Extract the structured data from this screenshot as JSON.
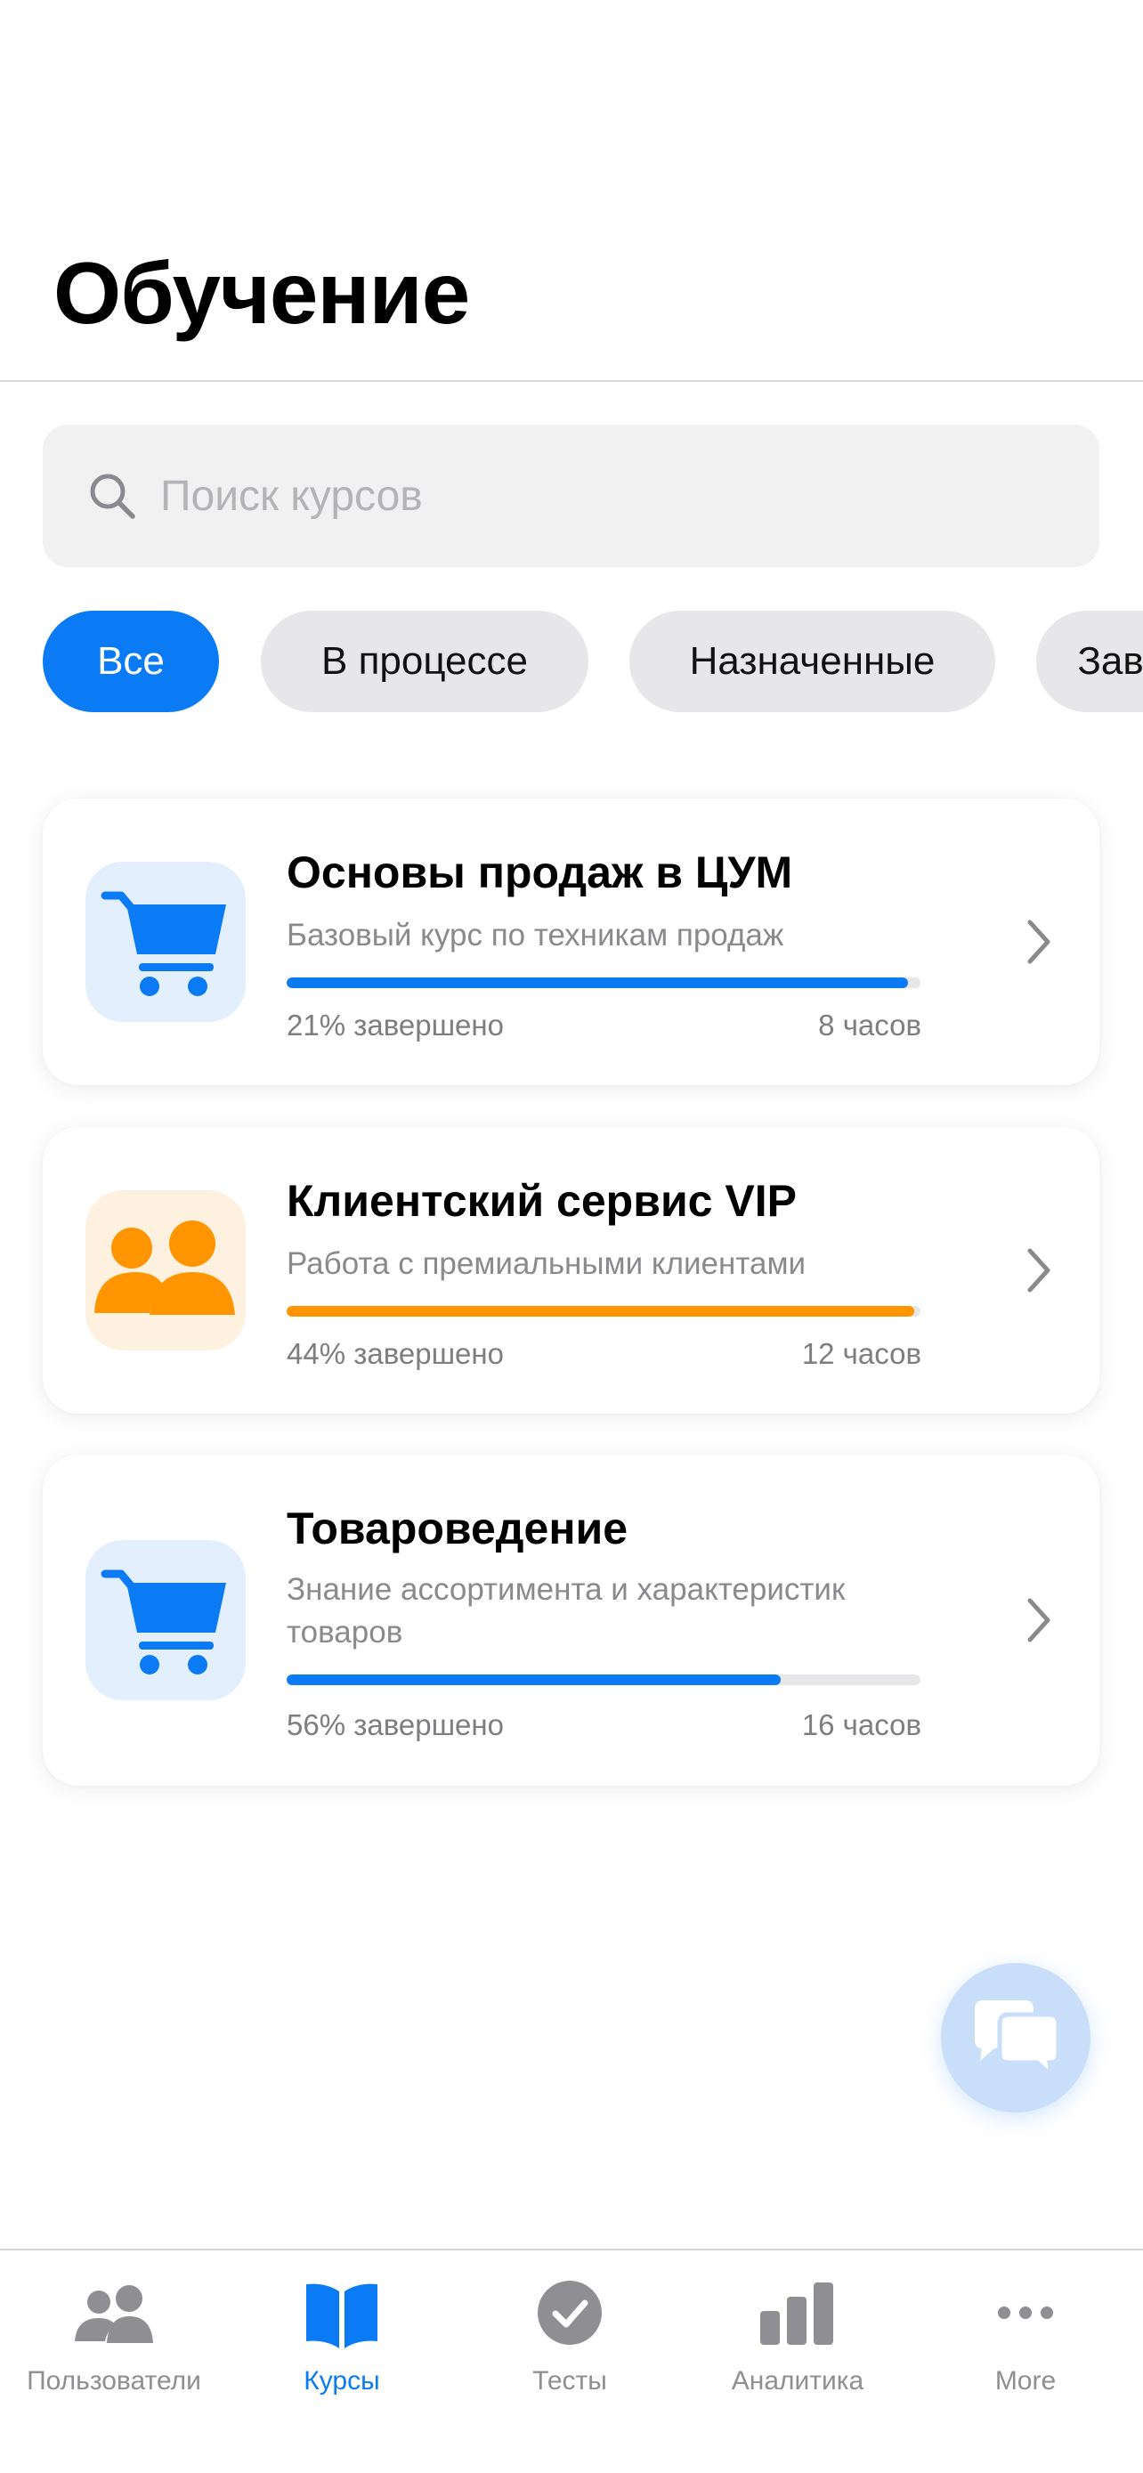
{
  "header": {
    "title": "Обучение"
  },
  "search": {
    "placeholder": "Поиск курсов"
  },
  "filters": [
    {
      "label": "Все",
      "active": true
    },
    {
      "label": "В процессе",
      "active": false
    },
    {
      "label": "Назначенные",
      "active": false
    },
    {
      "label": "Завершенные",
      "active": false
    }
  ],
  "courses": [
    {
      "title": "Основы продаж в ЦУМ",
      "description": "Базовый курс по техникам продаж",
      "progress_label": "21% завершено",
      "progress_value": 0.98,
      "hours": "8 часов",
      "icon": "cart-icon",
      "accent": "#0a7bf5"
    },
    {
      "title": "Клиентский сервис VIP",
      "description": "Работа с премиальными клиентами",
      "progress_label": "44% завершено",
      "progress_value": 0.99,
      "hours": "12 часов",
      "icon": "people-icon",
      "accent": "#ff9500"
    },
    {
      "title": "Товароведение",
      "description": "Знание ассортимента и характеристик товаров",
      "progress_label": "56% завершено",
      "progress_value": 0.78,
      "hours": "16 часов",
      "icon": "cart-icon",
      "accent": "#0a7bf5"
    }
  ],
  "tabs": [
    {
      "label": "Пользователи",
      "icon": "users-icon",
      "active": false
    },
    {
      "label": "Курсы",
      "icon": "book-icon",
      "active": true
    },
    {
      "label": "Тесты",
      "icon": "checkmark-circle-icon",
      "active": false
    },
    {
      "label": "Аналитика",
      "icon": "bar-chart-icon",
      "active": false
    },
    {
      "label": "More",
      "icon": "more-dots-icon",
      "active": false
    }
  ],
  "fab": {
    "icon": "chat-bubbles-icon"
  },
  "colors": {
    "accent": "#0a7bf5",
    "orange": "#ff9500",
    "inactive": "#8e8e93"
  }
}
